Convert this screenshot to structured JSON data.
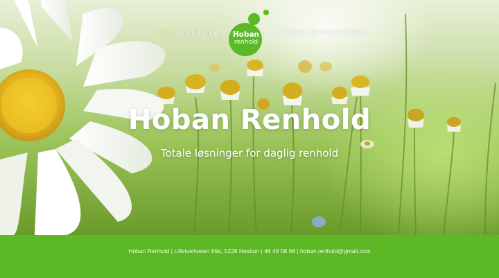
{
  "nav": {
    "items": [
      {
        "label": "HJEM"
      },
      {
        "label": "TJENESTER"
      },
      {
        "label": "PRISER"
      },
      {
        "label": "OM OSS/KONTAKT"
      }
    ]
  },
  "logo": {
    "line1": "Hoban",
    "line2": "renhold"
  },
  "hero": {
    "title": "Hoban Renhold",
    "subtitle": "Totale løsninger for daglig renhold"
  },
  "footer": {
    "info": "Hoban Renhold | Lilletveitveien 89a, 5228 Nesttun | 46 48 58 68 | hoban.renhold@gmail.com"
  },
  "colors": {
    "brand_green": "#5cb824",
    "active_nav": "#f4f7b8"
  }
}
